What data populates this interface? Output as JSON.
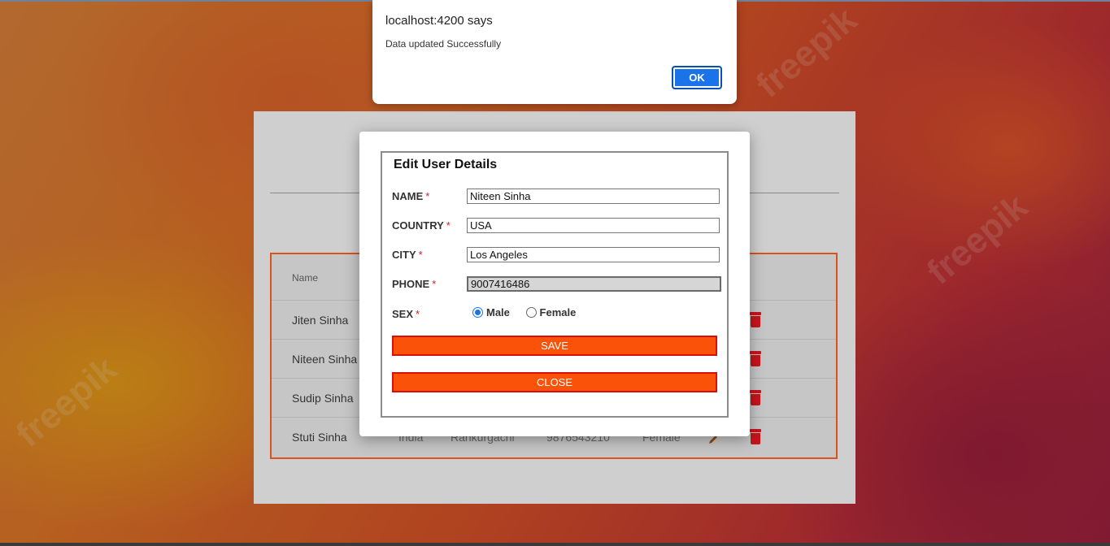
{
  "alert": {
    "title": "localhost:4200 says",
    "message": "Data updated Successfully",
    "ok_label": "OK"
  },
  "table": {
    "header_name": "Name",
    "rows": [
      {
        "name": "Jiten Sinha"
      },
      {
        "name": "Niteen Sinha"
      },
      {
        "name": "Sudip Sinha"
      },
      {
        "name": "Stuti Sinha",
        "country": "India",
        "city": "Rankurgachi",
        "phone": "9876543210",
        "sex": "Female"
      }
    ]
  },
  "modal": {
    "title": "Edit User Details",
    "fields": {
      "name": {
        "label": "NAME",
        "value": "Niteen Sinha"
      },
      "country": {
        "label": "COUNTRY",
        "value": "USA"
      },
      "city": {
        "label": "CITY",
        "value": "Los Angeles"
      },
      "phone": {
        "label": "PHONE",
        "value": "9007416486"
      }
    },
    "sex": {
      "label": "SEX",
      "options": [
        "Male",
        "Female"
      ],
      "selected": "Male"
    },
    "required_mark": "*",
    "save_label": "SAVE",
    "close_label": "CLOSE"
  },
  "watermark_text": "freepik",
  "colors": {
    "accent_orange": "#fa5209",
    "button_border_red": "#d60f0f",
    "table_border": "#d9531e",
    "delete_icon": "#c8141b",
    "ok_button": "#1a73e8"
  }
}
